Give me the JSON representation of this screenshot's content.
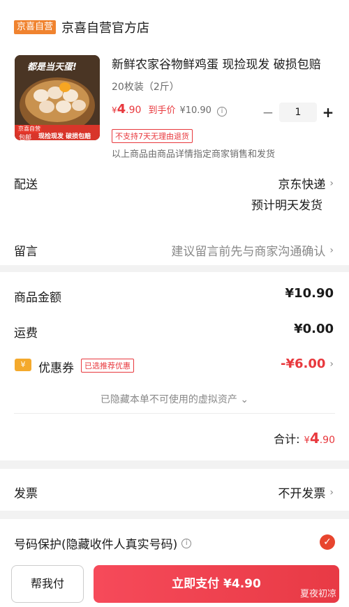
{
  "store": {
    "badge": "京喜自营",
    "name": "京喜自营官方店"
  },
  "product": {
    "title": "新鲜农家谷物鲜鸡蛋 现捡现发 破损包赔",
    "spec": "20枚装（2斤）",
    "price_currency": "¥",
    "price_int": "4",
    "price_cents": ".90",
    "arrival_label": "到手价",
    "arrival_price": "¥10.90",
    "quantity": "1",
    "return_tag": "不支持7天无理由退货",
    "merchant_note": "以上商品由商品详情指定商家销售和发货",
    "image_banner": "都是当天蛋!",
    "image_badge_top": "京喜自营",
    "image_badge_bottom": "包邮",
    "image_footer": "现捡现发 破损包赔"
  },
  "delivery": {
    "label": "配送",
    "carrier": "京东快递",
    "eta": "预计明天发货"
  },
  "message": {
    "label": "留言",
    "placeholder": "建议留言前先与商家沟通确认"
  },
  "summary": {
    "goods_label": "商品金额",
    "goods_value": "¥10.90",
    "freight_label": "运费",
    "freight_value": "¥0.00",
    "coupon_icon": "¥",
    "coupon_label": "优惠券",
    "coupon_tag": "已选推荐优惠",
    "coupon_value": "-¥6.00",
    "hidden_assets_note": "已隐藏本单不可使用的虚拟资产",
    "total_label": "合计:",
    "total_currency": "¥",
    "total_int": "4",
    "total_cents": ".90"
  },
  "invoice": {
    "label": "发票",
    "value": "不开发票"
  },
  "privacy": {
    "label": "号码保护(隐藏收件人真实号码)",
    "checked": true
  },
  "actions": {
    "help_pay": "帮我付",
    "pay_now": "立即支付 ¥4.90"
  },
  "watermark": "夏夜初凉",
  "colors": {
    "accent_red": "#e8383d",
    "badge_orange": "#f0832f"
  }
}
